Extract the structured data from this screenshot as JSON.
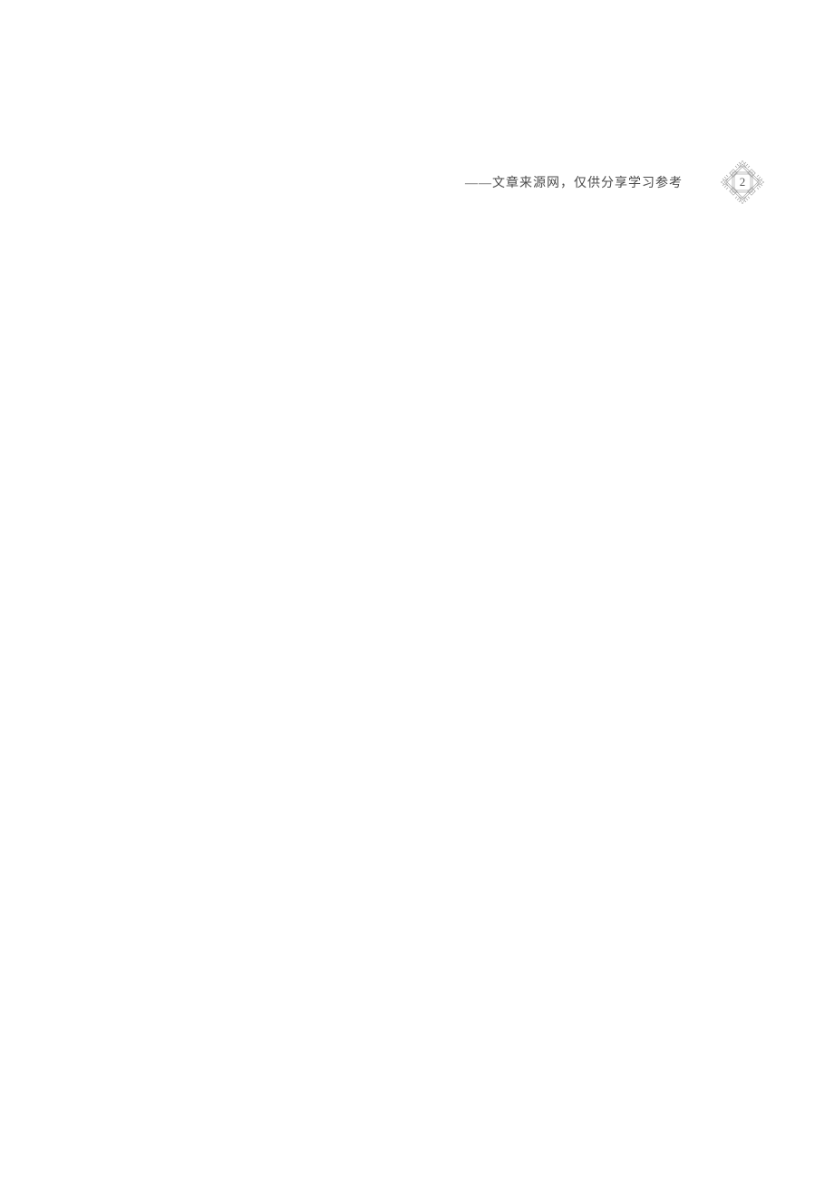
{
  "header": {
    "source_label": "——文章来源网，仅供分享学习参考",
    "page_number": "2"
  }
}
